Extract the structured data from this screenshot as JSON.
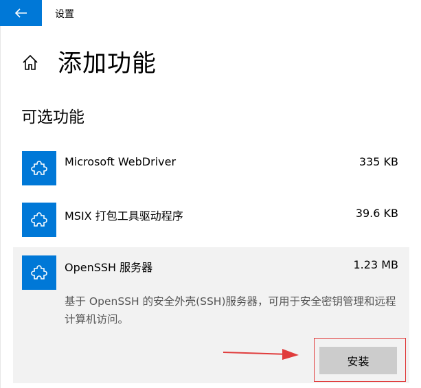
{
  "window": {
    "title": "设置"
  },
  "page": {
    "title": "添加功能"
  },
  "section": {
    "title": "可选功能"
  },
  "features": [
    {
      "name": "Microsoft WebDriver",
      "size": "335 KB",
      "icon": "puzzle-icon"
    },
    {
      "name": "MSIX 打包工具驱动程序",
      "size": "39.6 KB",
      "icon": "puzzle-icon"
    },
    {
      "name": "OpenSSH 服务器",
      "size": "1.23 MB",
      "icon": "puzzle-icon",
      "expanded": true,
      "description": "基于 OpenSSH 的安全外壳(SSH)服务器，可用于安全密钥管理和远程计算机访问。",
      "install_label": "安装"
    }
  ],
  "colors": {
    "accent": "#0078d7",
    "selected_bg": "#f2f2f2",
    "button_bg": "#cccccc",
    "annotation": "#e03c3c"
  }
}
